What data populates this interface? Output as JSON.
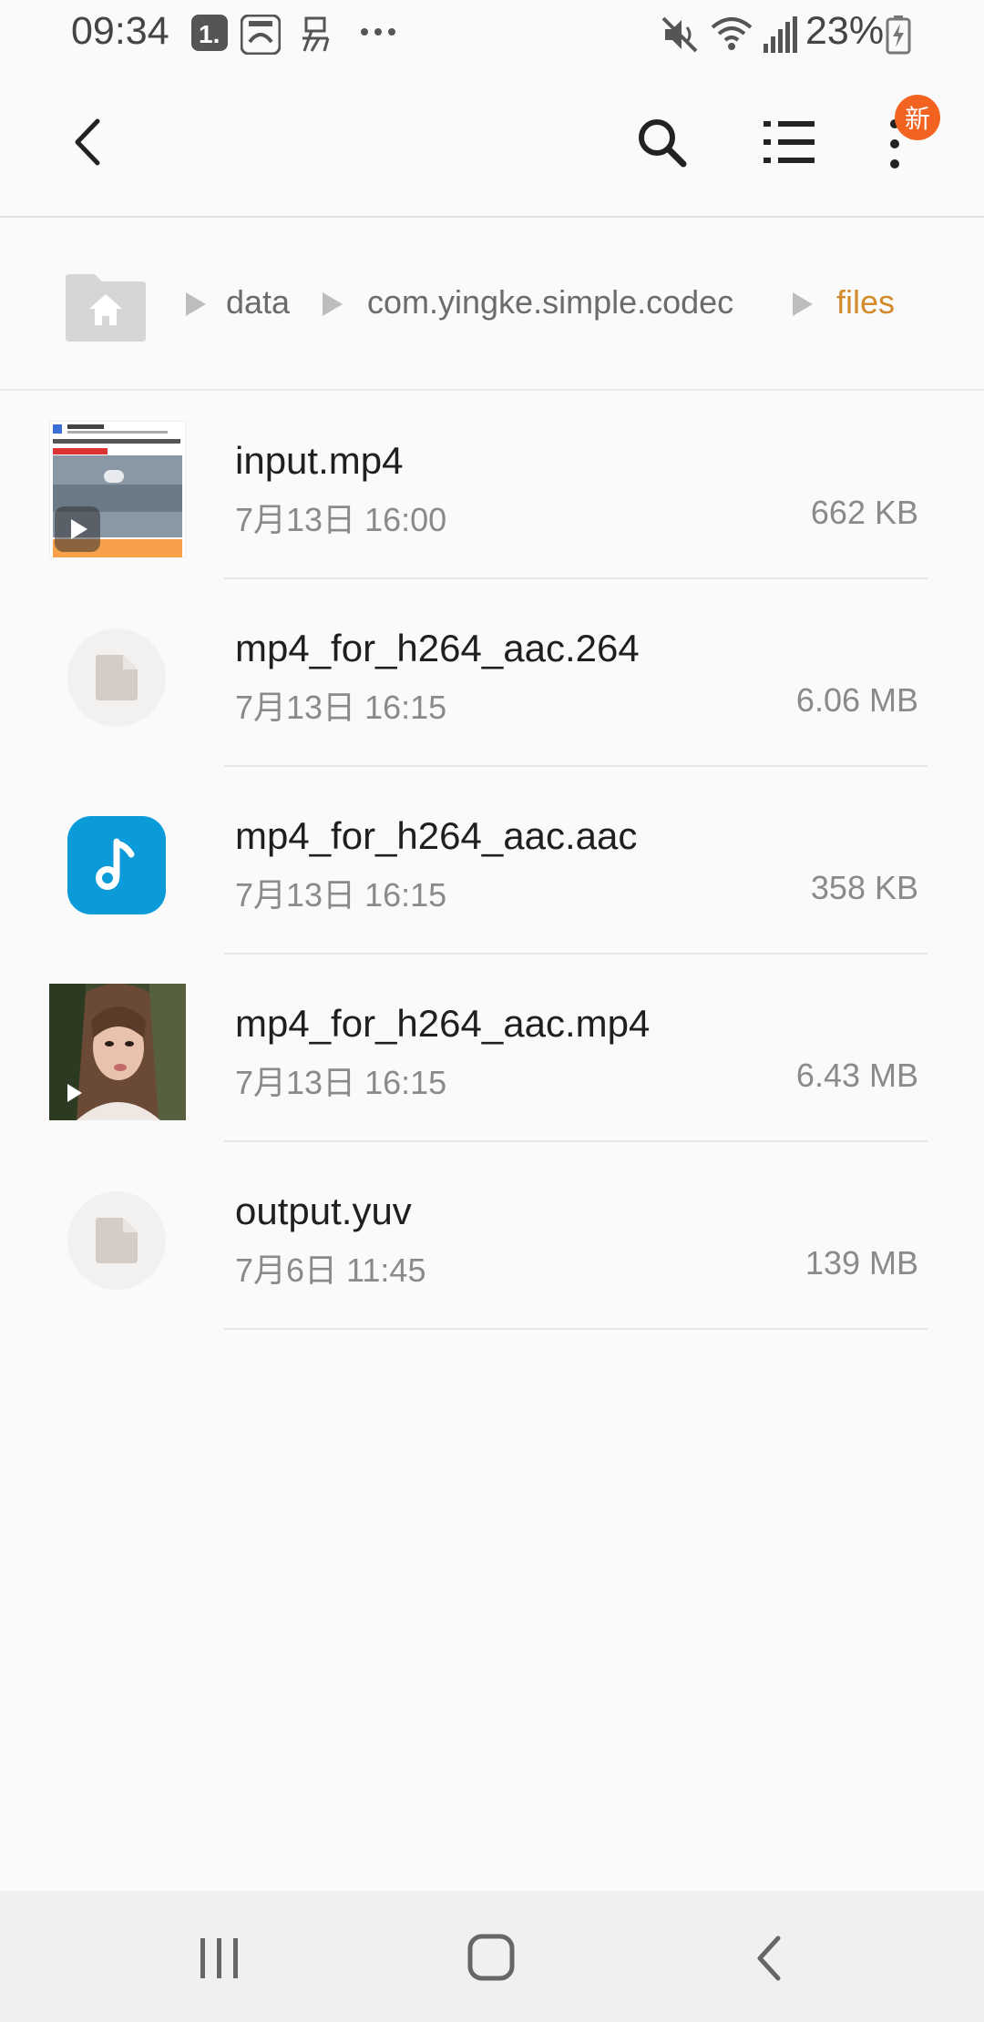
{
  "status_bar": {
    "time": "09:34",
    "notification_icons": [
      "1-app-icon",
      "sohu-icon",
      "yi-app-icon",
      "more-dots-icon"
    ],
    "system_icons": [
      "mute-icon",
      "wifi-icon",
      "signal-icon",
      "battery-icon"
    ],
    "battery_percent": "23%"
  },
  "action_bar": {
    "back_icon": "back-arrow-icon",
    "search_icon": "search-icon",
    "list_view_icon": "list-view-icon",
    "more_icon": "more-vert-icon",
    "badge": "新",
    "badge_color": "#f26322"
  },
  "breadcrumb": {
    "home_icon": "home-folder-icon",
    "items": [
      "data",
      "com.yingke.simple.codec",
      "files"
    ],
    "active_color": "#d28a2a"
  },
  "files": [
    {
      "name": "input.mp4",
      "date": "7月13日 16:00",
      "size": "662 KB",
      "icon": "video-thumbnail"
    },
    {
      "name": "mp4_for_h264_aac.264",
      "date": "7月13日 16:15",
      "size": "6.06 MB",
      "icon": "generic-file-icon"
    },
    {
      "name": "mp4_for_h264_aac.aac",
      "date": "7月13日 16:15",
      "size": "358 KB",
      "icon": "audio-file-icon"
    },
    {
      "name": "mp4_for_h264_aac.mp4",
      "date": "7月13日 16:15",
      "size": "6.43 MB",
      "icon": "video-thumbnail"
    },
    {
      "name": "output.yuv",
      "date": "7月6日 11:45",
      "size": "139 MB",
      "icon": "generic-file-icon"
    }
  ],
  "nav_bar": {
    "recents_icon": "recents-icon",
    "home_icon": "home-icon",
    "back_icon": "back-icon"
  }
}
